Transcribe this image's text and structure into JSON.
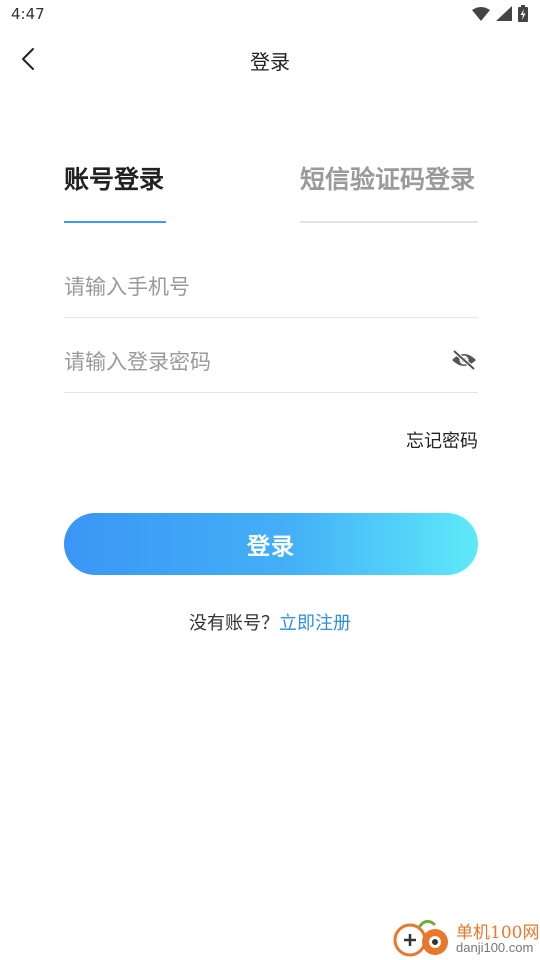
{
  "status_bar": {
    "time": "4:47",
    "icons": [
      "wifi-icon",
      "signal-icon",
      "battery-icon"
    ]
  },
  "header": {
    "title": "登录",
    "back_icon": "chevron-left-icon"
  },
  "tabs": [
    {
      "label": "账号登录",
      "active": true
    },
    {
      "label": "短信验证码登录",
      "active": false
    }
  ],
  "form": {
    "phone_placeholder": "请输入手机号",
    "phone_value": "",
    "password_placeholder": "请输入登录密码",
    "password_value": "",
    "password_toggle_icon": "eye-off-icon",
    "forgot_label": "忘记密码"
  },
  "login_button": {
    "label": "登录"
  },
  "register": {
    "prompt": "没有账号？",
    "link": "立即注册"
  },
  "watermark": {
    "text_cn": "单机100网",
    "text_en": "danji100.com"
  },
  "colors": {
    "accent": "#3d9cf4",
    "link": "#2f8ee8",
    "button_gradient_start": "#3a96f5",
    "button_gradient_end": "#5eeaf9",
    "placeholder": "#9a9a9a"
  }
}
